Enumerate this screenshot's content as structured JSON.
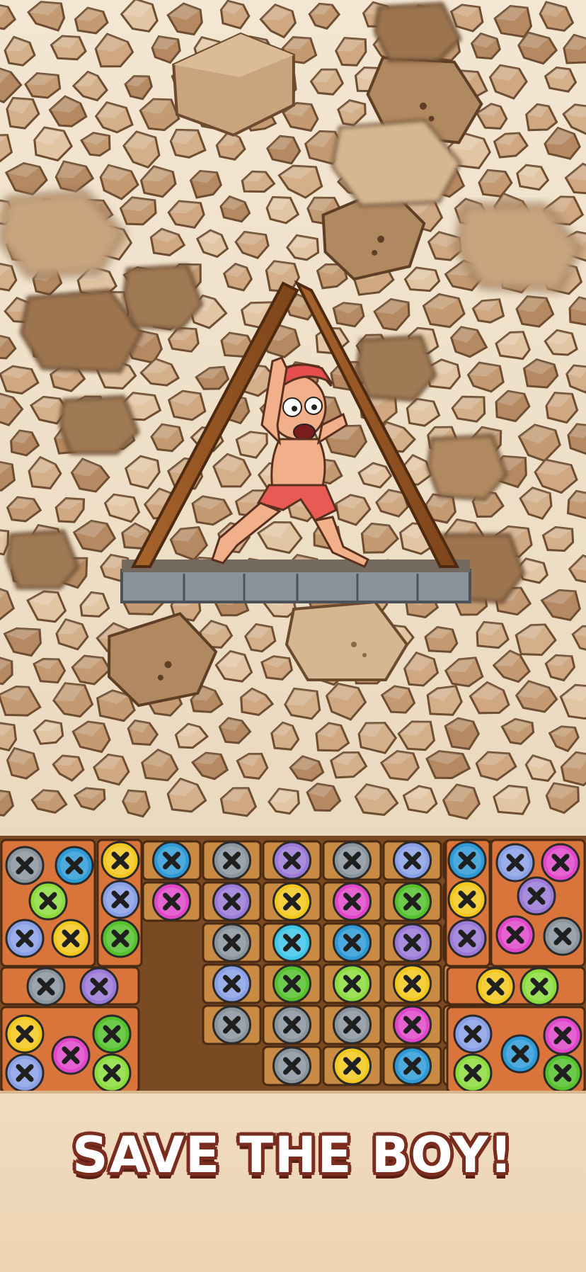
{
  "headline": "SAVE THE BOY!",
  "colors": {
    "wood_board": "#d9753a",
    "wood_tile": "#c98a44",
    "stone": "#c8a27c",
    "screw_gray": "#8a959e",
    "screw_blue": "#2f9bd6",
    "screw_green": "#55c12d",
    "screw_yellow": "#f2c81e",
    "screw_purple": "#9b7ad8",
    "screw_magenta": "#e048c9",
    "screw_periwinkle": "#8aa0e6",
    "screw_cyan": "#3fc6e8",
    "screw_lime": "#8bdc3c"
  },
  "puzzle": {
    "columns": [
      {
        "screws": [
          "blue",
          "magenta"
        ]
      },
      {
        "screws": [
          "gray",
          "purple",
          "gray",
          "periwinkle",
          "gray"
        ]
      },
      {
        "screws": [
          "purple",
          "yellow",
          "cyan",
          "green",
          "gray",
          "gray"
        ]
      },
      {
        "screws": [
          "gray",
          "magenta",
          "blue",
          "lime",
          "gray",
          "yellow"
        ]
      },
      {
        "screws": [
          "periwinkle",
          "green",
          "purple",
          "yellow",
          "magenta",
          "blue"
        ]
      },
      {
        "screws": [
          "magenta",
          "cyan",
          "gray",
          "green",
          "yellow",
          "gray"
        ]
      },
      {
        "screws": [
          "blue",
          "yellow",
          "purple"
        ]
      }
    ]
  }
}
